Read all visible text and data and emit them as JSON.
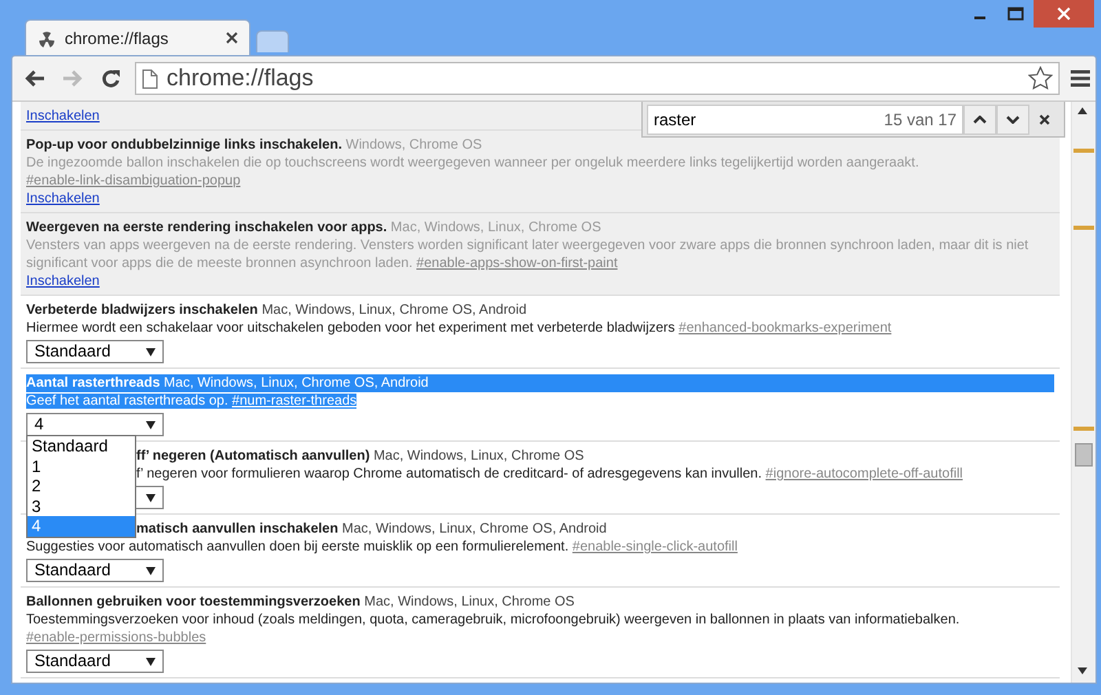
{
  "tabs": [
    {
      "title": "chrome://flags",
      "selected": true
    },
    {
      "selected": false
    }
  ],
  "address_bar": {
    "url": "chrome://flags"
  },
  "toolbar": {
    "forward_disabled": true
  },
  "find_bar": {
    "query": "raster",
    "count": "15 van 17"
  },
  "experiments": [
    {
      "kind": "disabled",
      "action": "Inschakelen"
    },
    {
      "kind": "disabled",
      "title": "Pop-up voor ondubbelzinnige links inschakelen.",
      "platforms": "Windows, Chrome OS",
      "description": "De ingezoomde ballon inschakelen die op touchscreens wordt weergegeven wanneer per ongeluk meerdere links tegelijkertijd worden aangeraakt.",
      "link": "#enable-link-disambiguation-popup",
      "action": "Inschakelen"
    },
    {
      "kind": "disabled",
      "title": "Weergeven na eerste rendering inschakelen voor apps.",
      "platforms": "Mac, Windows, Linux, Chrome OS",
      "description": "Vensters van apps weergeven na de eerste rendering. Vensters worden significant later weergegeven voor zware apps die bronnen synchroon laden, maar dit is niet significant voor apps die de meeste bronnen asynchroon laden.",
      "link": "#enable-apps-show-on-first-paint",
      "action": "Inschakelen"
    },
    {
      "kind": "select",
      "title": "Verbeterde bladwijzers inschakelen",
      "platforms": "Mac, Windows, Linux, Chrome OS, Android",
      "description": "Hiermee wordt een schakelaar voor uitschakelen geboden voor het experiment met verbeterde bladwijzers",
      "link": "#enhanced-bookmarks-experiment",
      "value": "Standaard",
      "highlighted": false
    },
    {
      "kind": "select",
      "title": "Aantal rasterthreads",
      "platforms": "Mac, Windows, Linux, Chrome OS, Android",
      "description": "Geef het aantal rasterthreads op.",
      "link": "#num-raster-threads",
      "value": "4",
      "highlighted": true,
      "options": [
        {
          "label": "Standaard",
          "selected": false
        },
        {
          "label": "1",
          "selected": false
        },
        {
          "label": "2",
          "selected": false
        },
        {
          "label": "3",
          "selected": false
        },
        {
          "label": "4",
          "selected": true
        }
      ]
    },
    {
      "kind": "select",
      "title": "ff’ negeren (Automatisch aanvullen)",
      "platforms": "Mac, Windows, Linux, Chrome OS",
      "description": "f’ negeren voor formulieren waarop Chrome automatisch de creditcard- of adresgegevens kan invullen.",
      "link": "#ignore-autocomplete-off-autofill",
      "title_covered": true,
      "description_covered": true,
      "highlighted": false
    },
    {
      "kind": "select",
      "title": "matisch aanvullen inschakelen",
      "platforms": "Mac, Windows, Linux, Chrome OS, Android",
      "description": "Suggesties voor automatisch aanvullen doen bij eerste muisklik op een formulierelement.",
      "link": "#enable-single-click-autofill",
      "value": "Standaard",
      "title_covered": true,
      "highlighted": false
    },
    {
      "kind": "select",
      "title": "Ballonnen gebruiken voor toestemmingsverzoeken",
      "platforms": "Mac, Windows, Linux, Chrome OS",
      "description": "Toestemmingsverzoeken voor inhoud (zoals meldingen, quota, cameragebruik, microfoongebruik) weergeven in ballonnen in plaats van informatiebalken.",
      "link": "#enable-permissions-bubbles",
      "value": "Standaard",
      "highlighted": false
    }
  ]
}
